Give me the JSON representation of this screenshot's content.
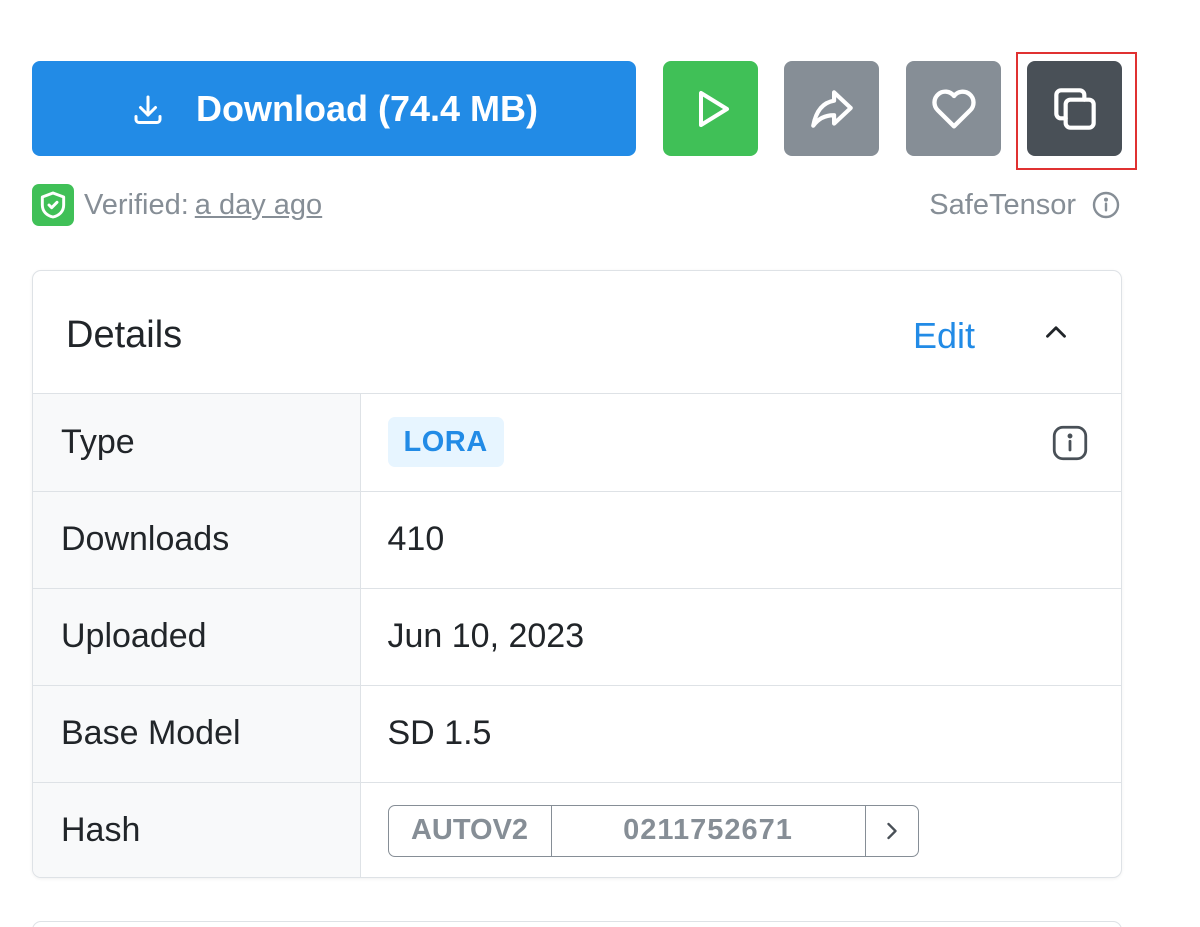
{
  "actions": {
    "download_label": "Download (74.4 MB)",
    "download_icon": "download-icon",
    "play_icon": "play-icon",
    "share_icon": "share-icon",
    "like_icon": "heart-icon",
    "copy_icon": "copy-icon",
    "colors": {
      "download": "#228be6",
      "play": "#40c057",
      "share": "#868e96",
      "like": "#868e96",
      "copy": "#495057",
      "focus": "#e03131"
    }
  },
  "meta": {
    "verified_label": "Verified:",
    "verified_time": "a day ago",
    "format_label": "SafeTensor"
  },
  "details": {
    "title": "Details",
    "edit_label": "Edit",
    "rows": {
      "type": {
        "label": "Type",
        "value": "LORA"
      },
      "downloads": {
        "label": "Downloads",
        "value": "410"
      },
      "uploaded": {
        "label": "Uploaded",
        "value": "Jun 10, 2023"
      },
      "base_model": {
        "label": "Base Model",
        "value": "SD 1.5"
      },
      "hash": {
        "label": "Hash",
        "type": "AUTOV2",
        "value": "0211752671"
      }
    }
  }
}
